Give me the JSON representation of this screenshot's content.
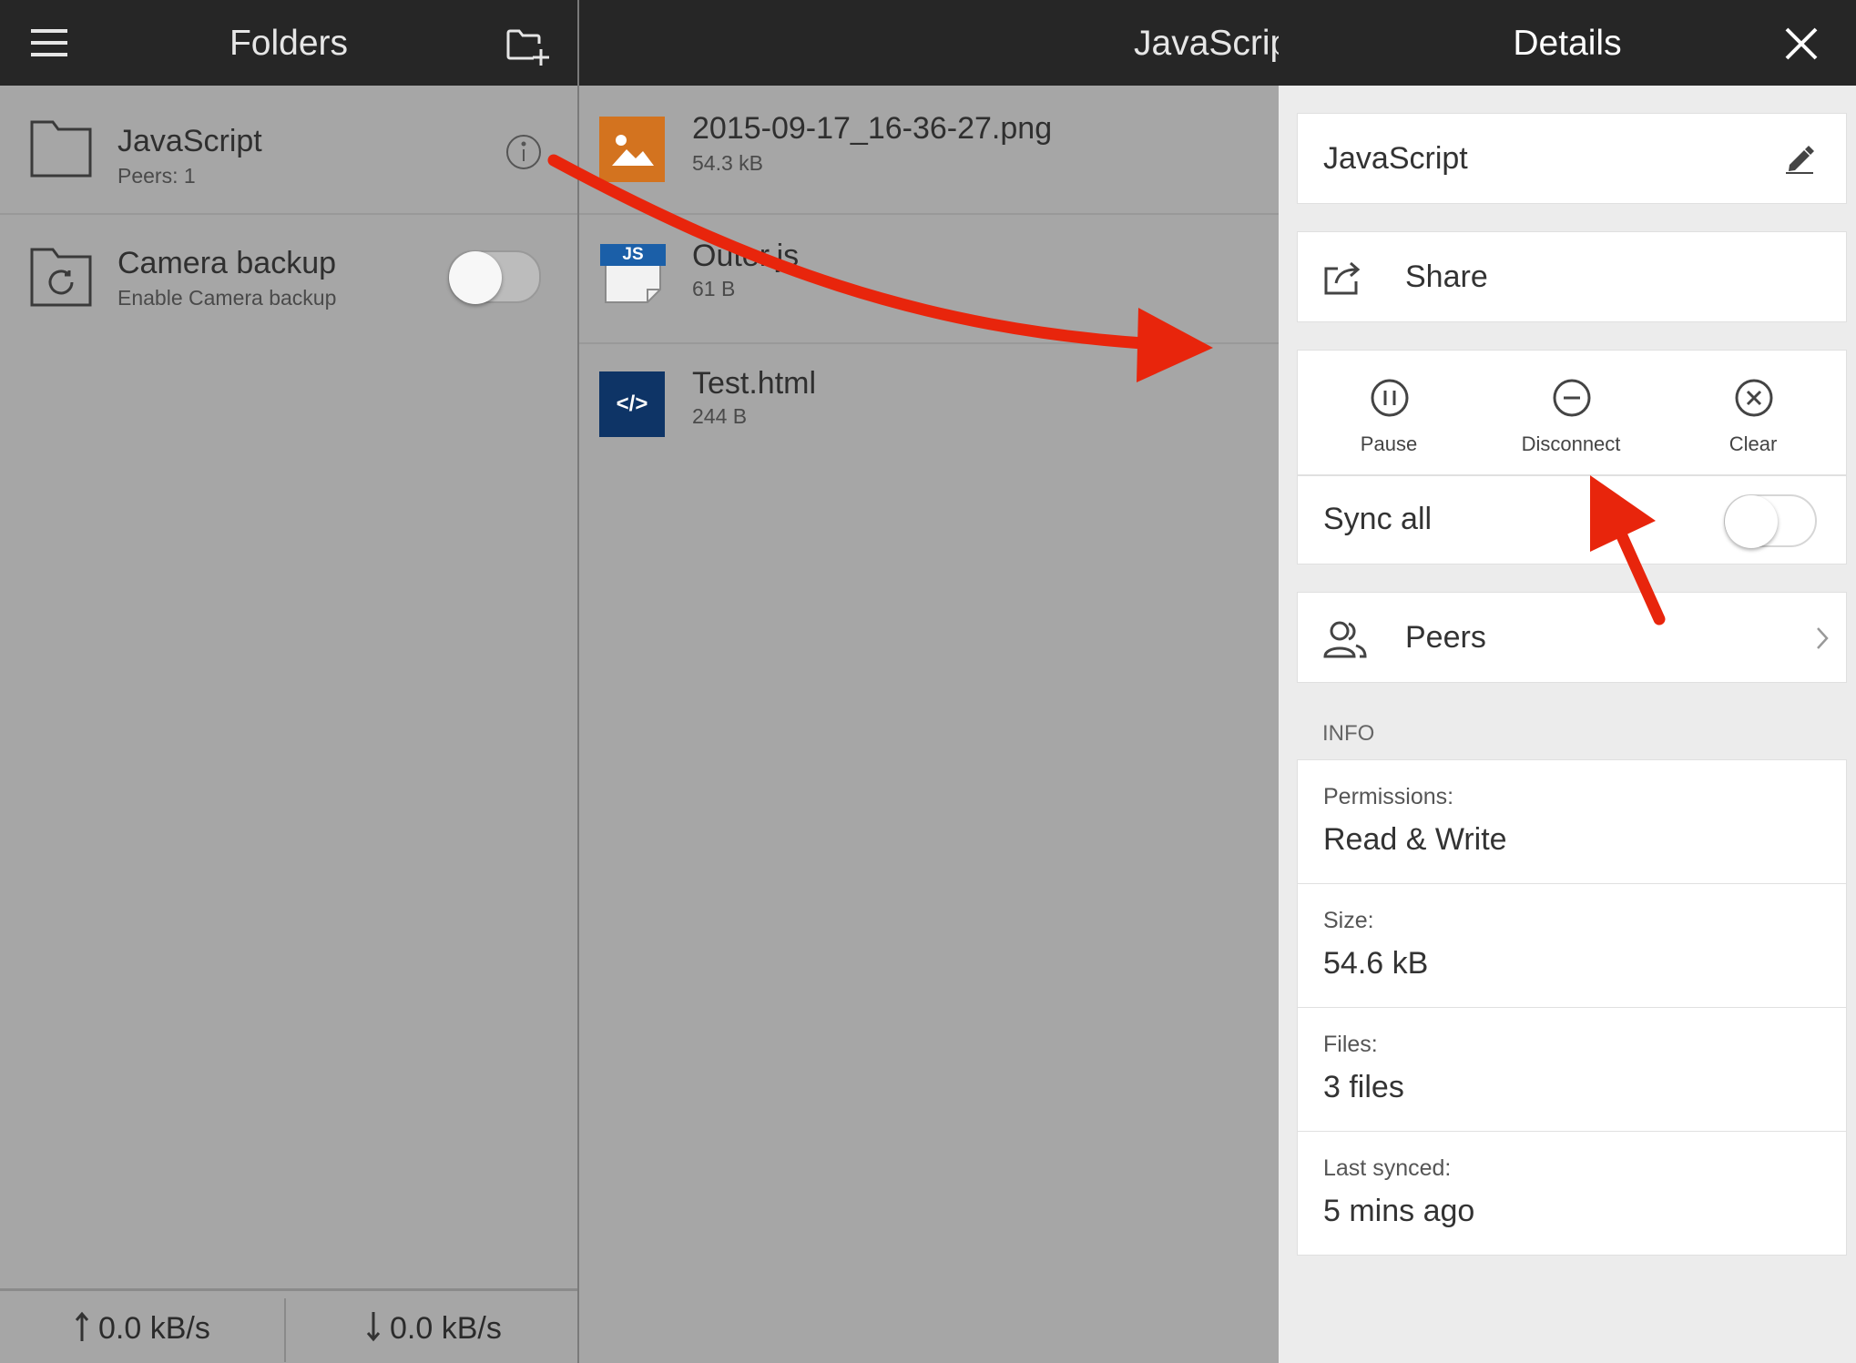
{
  "folders_pane": {
    "title": "Folders",
    "items": [
      {
        "name": "JavaScript",
        "subtitle": "Peers: 1"
      },
      {
        "name": "Camera backup",
        "subtitle": "Enable Camera backup"
      }
    ],
    "footer": {
      "upload": "0.0 kB/s",
      "download": "0.0 kB/s"
    }
  },
  "files_pane": {
    "title": "JavaScript",
    "files": [
      {
        "name": "2015-09-17_16-36-27.png",
        "size": "54.3 kB",
        "icon": "image-file-icon",
        "color": "#d3731f"
      },
      {
        "name": "Outer.js",
        "size": "61 B",
        "icon": "js-file-icon",
        "badge": "JS",
        "color": "#1b5fa8"
      },
      {
        "name": "Test.html",
        "size": "244 B",
        "icon": "html-file-icon",
        "badge": "</>",
        "color": "#0e3466"
      }
    ]
  },
  "details": {
    "title": "Details",
    "folder_name": "JavaScript",
    "share_label": "Share",
    "actions": {
      "pause": "Pause",
      "disconnect": "Disconnect",
      "clear": "Clear"
    },
    "sync_all": {
      "label": "Sync all",
      "on": false
    },
    "peers_label": "Peers",
    "info_header": "INFO",
    "info": [
      {
        "label": "Permissions:",
        "value": "Read & Write"
      },
      {
        "label": "Size:",
        "value": "54.6 kB"
      },
      {
        "label": "Files:",
        "value": "3 files"
      },
      {
        "label": "Last synced:",
        "value": "5 mins ago"
      }
    ]
  },
  "colors": {
    "annotation_arrow": "#e8250c",
    "header": "#262626",
    "details_bg": "#ececec"
  }
}
